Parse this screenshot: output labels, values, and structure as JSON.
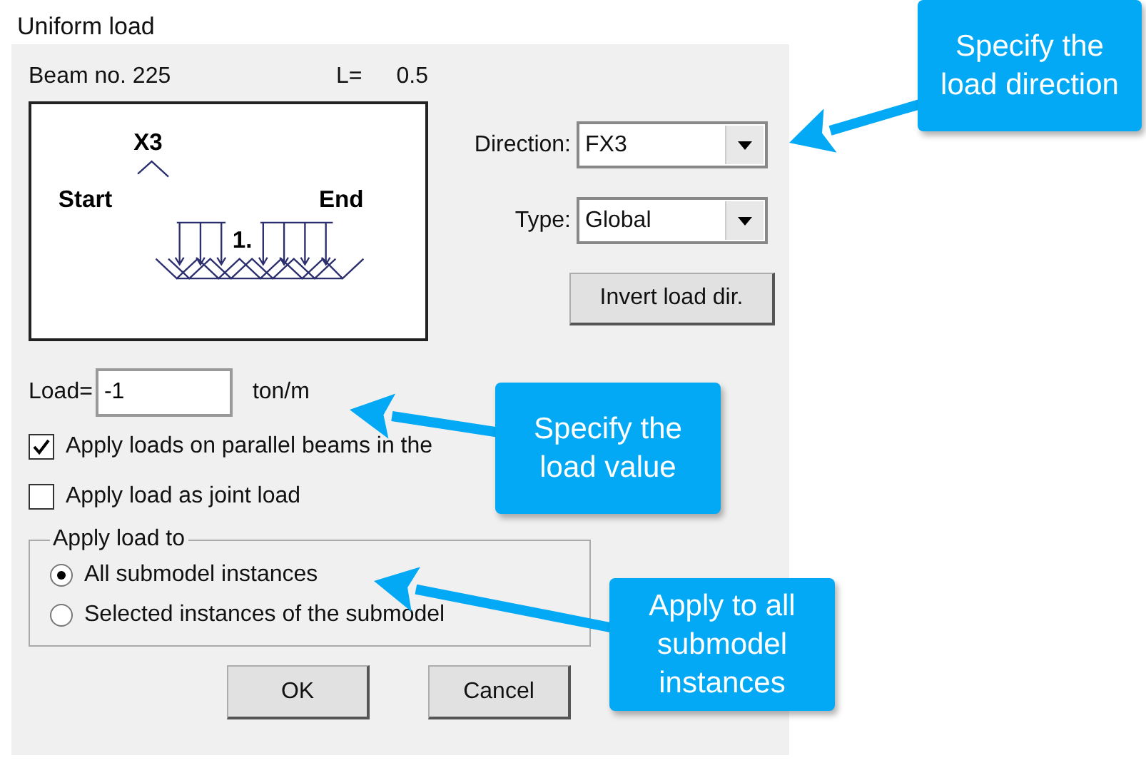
{
  "window": {
    "title": "Uniform load"
  },
  "beam": {
    "label": "Beam no. 225",
    "length_label": "L=",
    "length": "0.5",
    "diagram": {
      "axis": "X3",
      "start": "Start",
      "end": "End",
      "load": "1."
    }
  },
  "direction": {
    "label": "Direction:",
    "value": "FX3"
  },
  "type": {
    "label": "Type:",
    "value": "Global"
  },
  "invert_button": "Invert load dir.",
  "load": {
    "label": "Load=",
    "value": "-1",
    "unit": "ton/m"
  },
  "options": [
    {
      "label": "Apply loads on parallel beams in the",
      "checked": true
    },
    {
      "label": "Apply load as joint load",
      "checked": false
    }
  ],
  "apply_to": {
    "title": "Apply load to",
    "choices": [
      {
        "label": "All submodel instances",
        "selected": true
      },
      {
        "label": "Selected instances of the submodel",
        "selected": false
      }
    ]
  },
  "buttons": [
    "OK",
    "Cancel"
  ],
  "callouts": [
    "Specify the load direction",
    "Specify the load value",
    "Apply to all submodel instances"
  ]
}
